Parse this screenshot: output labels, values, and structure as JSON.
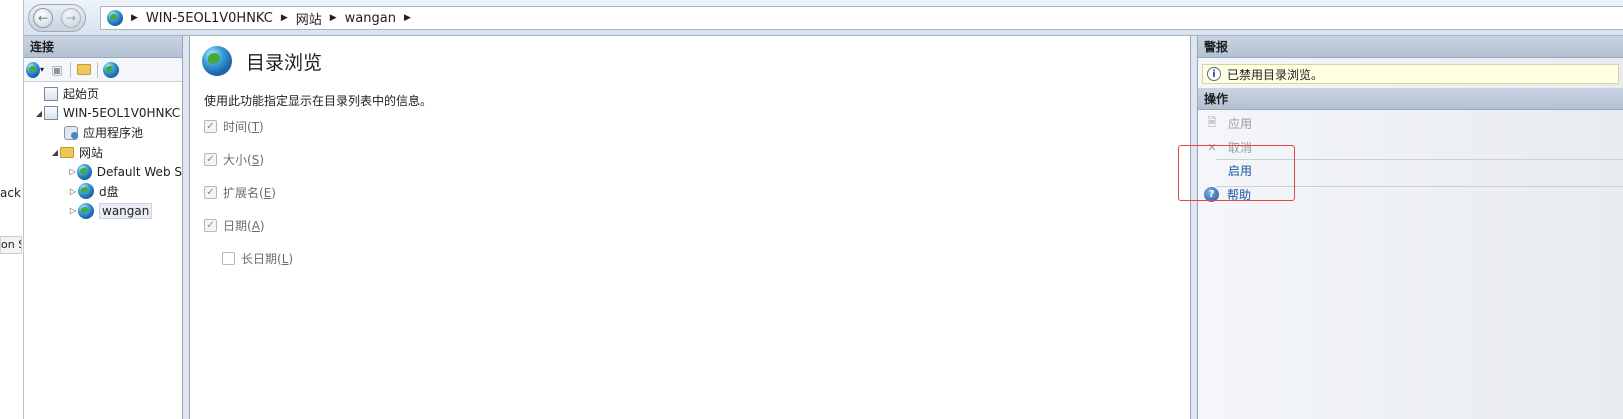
{
  "left_edge": {
    "cut_text_1": "ack",
    "cut_text_2": "on S"
  },
  "address": {
    "crumbs": [
      "WIN-5EOL1V0HNKC",
      "网站",
      "wangan"
    ]
  },
  "connections": {
    "header": "连接",
    "tree": [
      {
        "label": "起始页"
      },
      {
        "label": "WIN-5EOL1V0HNKC"
      },
      {
        "label": "应用程序池"
      },
      {
        "label": "网站"
      },
      {
        "label": "Default Web S"
      },
      {
        "label": "d盘"
      },
      {
        "label": "wangan"
      }
    ]
  },
  "content": {
    "title": "目录浏览",
    "description": "使用此功能指定显示在目录列表中的信息。",
    "options": [
      {
        "label": "时间(",
        "key": "T",
        "suffix": ")",
        "checked": true
      },
      {
        "label": "大小(",
        "key": "S",
        "suffix": ")",
        "checked": true
      },
      {
        "label": "扩展名(",
        "key": "E",
        "suffix": ")",
        "checked": true
      },
      {
        "label": "日期(",
        "key": "A",
        "suffix": ")",
        "checked": true
      },
      {
        "label": "长日期(",
        "key": "L",
        "suffix": ")",
        "checked": false
      }
    ]
  },
  "actions": {
    "alerts_header": "警报",
    "alert_text": "已禁用目录浏览。",
    "ops_header": "操作",
    "apply": "应用",
    "cancel": "取消",
    "enable": "启用",
    "help": "帮助"
  },
  "colors": {
    "highlight_border": "#e04848",
    "link": "#1d55a8",
    "disabled": "#9c9c9c"
  }
}
